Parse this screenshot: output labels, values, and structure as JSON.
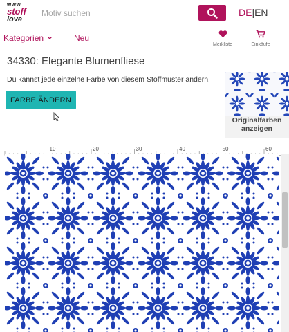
{
  "header": {
    "logo": {
      "line1": "www",
      "line2": "stoff",
      "line3": "love"
    },
    "search_placeholder": "Motiv suchen",
    "lang": {
      "de": "DE",
      "sep": "|",
      "en": "EN"
    }
  },
  "nav": {
    "categories": "Kategorien",
    "new": "Neu",
    "wishlist": "Merkliste",
    "cart": "Einkäufe"
  },
  "product": {
    "title": "34330: Elegante Blumenfliese",
    "description": "Du kannst jede einzelne Farbe von diesem Stoffmuster ändern.",
    "change_color_button": "FARBE ÄNDERN",
    "original_colors_line1": "Originalfarben",
    "original_colors_line2": "anzeigen"
  },
  "ruler": {
    "ticks": [
      "10",
      "20",
      "30",
      "40",
      "50",
      "60"
    ]
  },
  "colors": {
    "brand": "#b0135b",
    "accent": "#1fb5b2",
    "pattern_blue": "#1f3fb4"
  }
}
